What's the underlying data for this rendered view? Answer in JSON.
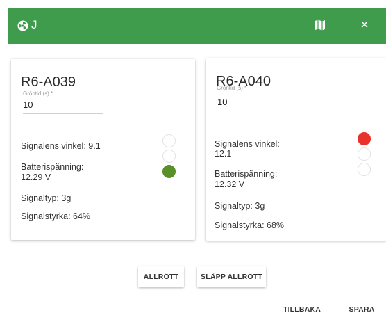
{
  "header": {
    "title": "J",
    "bg_color": "#3f9c4c",
    "left_icon": "nuclear-icon",
    "map_icon": "map-icon",
    "close_glyph": "×"
  },
  "cards": [
    {
      "title": "R6-A039",
      "field_label": "Gröntid (s) *",
      "field_value": "10",
      "signal_angle": "Signalens vinkel: 9.1",
      "battery_label": "Batterispänning:",
      "battery_value": "12.29 V",
      "signal_type": "Signaltyp: 3g",
      "signal_strength": "Signalstyrka: 64%",
      "lights": [
        "off",
        "off",
        "green"
      ]
    },
    {
      "title": "R6-A040",
      "field_label": "Gröntid (s) *",
      "field_value": "10",
      "signal_angle_label": "Signalens vinkel:",
      "signal_angle_value": "12.1",
      "battery_label": "Batterispänning:",
      "battery_value": "12.32 V",
      "signal_type": "Signaltyp: 3g",
      "signal_strength": "Signalstyrka: 68%",
      "lights": [
        "red",
        "off",
        "off"
      ]
    }
  ],
  "actions": {
    "all_red": "ALLRÖTT",
    "release_all_red": "SLÄPP ALLRÖTT",
    "back": "TILLBAKA",
    "save": "SPARA"
  },
  "colors": {
    "green_light": "#5a8f2a",
    "red_light": "#e8322c"
  }
}
